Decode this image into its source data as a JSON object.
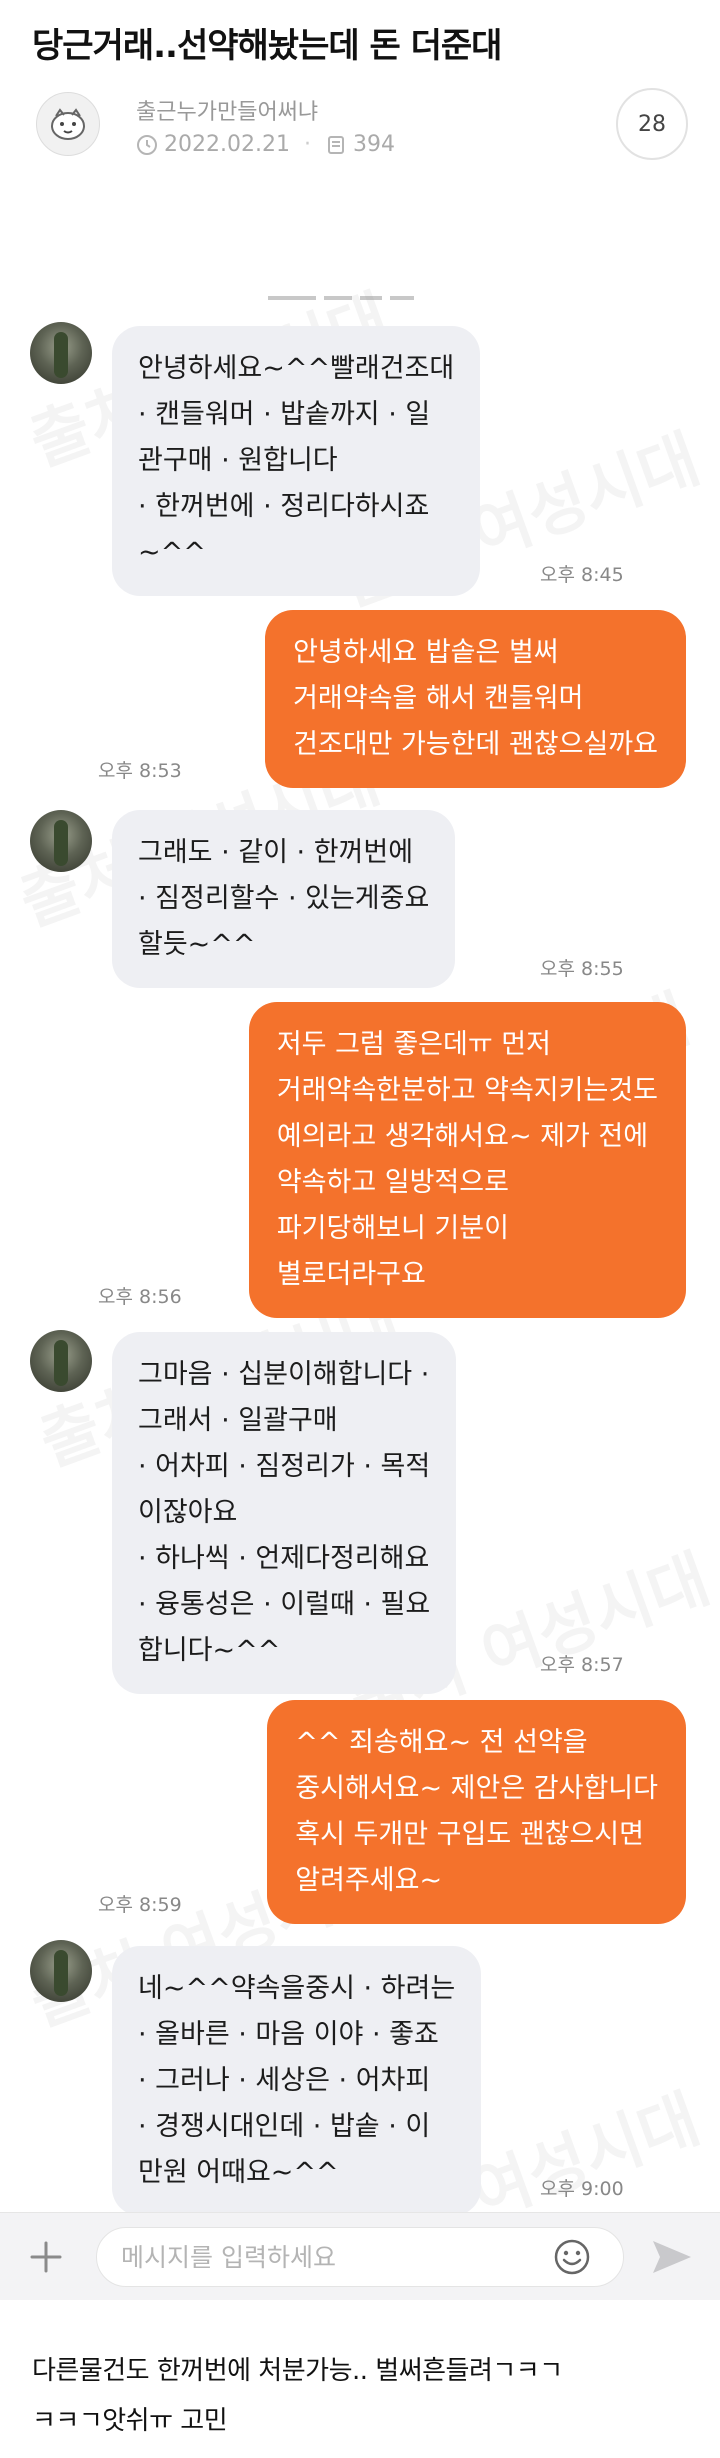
{
  "post": {
    "title": "당근거래..선약해놨는데 돈 더준대",
    "author": "출근누가만들어써냐",
    "date": "2022.02.21",
    "views": "394",
    "comments": "28"
  },
  "watermark": "출처 여성시대",
  "messages": [
    {
      "side": "in",
      "text": "안녕하세요~^^빨래건조대\n· 캔들워머 · 밥솥까지 · 일\n관구매 · 원합니다\n· 한꺼번에 · 정리다하시죠\n~^^",
      "time": "오후 8:45"
    },
    {
      "side": "out",
      "text": "안녕하세요 밥솥은 벌써\n거래약속을 해서 캔들워머\n건조대만 가능한데 괜찮으실까요",
      "time": "오후 8:53"
    },
    {
      "side": "in",
      "text": "그래도 · 같이 · 한꺼번에\n· 짐정리할수 · 있는게중요\n할듯~^^",
      "time": "오후 8:55"
    },
    {
      "side": "out",
      "text": "저두 그럼 좋은데ㅠ 먼저\n거래약속한분하고 약속지키는것도\n예의라고 생각해서요~ 제가 전에\n약속하고 일방적으로\n파기당해보니 기분이\n별로더라구요",
      "time": "오후 8:56"
    },
    {
      "side": "in",
      "text": "그마음 · 십분이해합니다 ·\n그래서 · 일괄구매\n· 어차피 · 짐정리가 · 목적\n이잖아요\n· 하나씩 · 언제다정리해요\n· 융통성은 · 이럴때 · 필요\n합니다~^^",
      "time": "오후 8:57"
    },
    {
      "side": "out",
      "text": "^^ 죄송해요~ 전 선약을\n중시해서요~ 제안은 감사합니다\n혹시 두개만 구입도 괜찮으시면\n알려주세요~",
      "time": "오후 8:59"
    },
    {
      "side": "in",
      "text": "네~^^약속을중시 · 하려는\n· 올바른 · 마음 이야 · 좋죠\n· 그러나 · 세상은 · 어차피\n· 경쟁시대인데 · 밥솥 · 이\n만원 어때요~^^",
      "time": "오후 9:00"
    }
  ],
  "input": {
    "placeholder": "메시지를 입력하세요"
  },
  "icons": {
    "plus": "plus-icon",
    "emoji": "emoji-icon",
    "send": "send-icon",
    "clock": "clock-icon",
    "views": "document-icon"
  },
  "colors": {
    "outgoing": "#f4722c",
    "incoming": "#eeeff3"
  },
  "caption": "다른물건도 한꺼번에 처분가능.. 벌써흔들려ㄱㅋㄱ\nㅋㅋㄱ앗쉬ㅠ 고민"
}
